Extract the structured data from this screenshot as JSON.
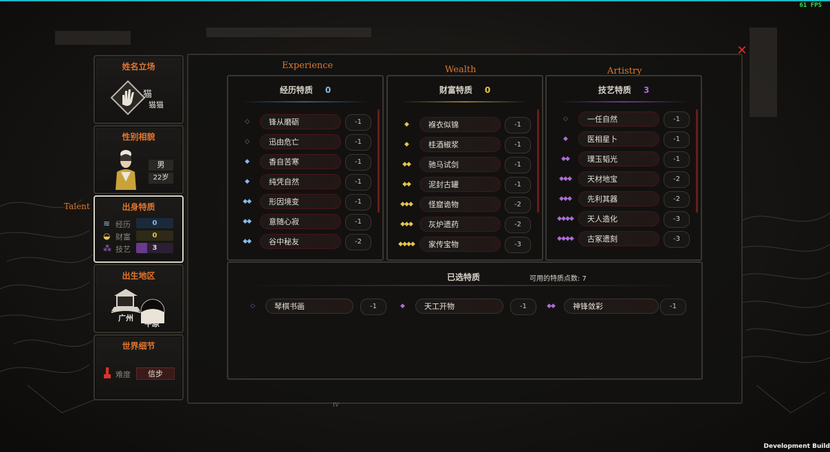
{
  "hud": {
    "fps": "61 FPS",
    "build": "Development Build"
  },
  "overlay": {
    "talent_label": "Talent"
  },
  "colors": {
    "accent_orange": "#e1752f",
    "experience_blue": "#8ab8e8",
    "wealth_gold": "#e7c44d",
    "artistry_purple": "#b06ad8",
    "close_red": "#d8332a"
  },
  "sidebar": {
    "name_section": {
      "title": "姓名立场",
      "name1": "猫",
      "name2": "猫猫",
      "icon": "palm-stance-icon"
    },
    "gender_section": {
      "title": "性别相貌",
      "gender": "男",
      "age": "22岁"
    },
    "origin_section": {
      "title": "出身特质",
      "stats": [
        {
          "label": "经历",
          "value": "0",
          "icon": "experience-icon"
        },
        {
          "label": "财富",
          "value": "0",
          "icon": "wealth-icon"
        },
        {
          "label": "技艺",
          "value": "3",
          "icon": "artistry-icon"
        }
      ]
    },
    "birthplace_section": {
      "title": "出生地区",
      "city": "广州",
      "terrain": "平原"
    },
    "world_section": {
      "title": "世界细节",
      "difficulty_label": "难度",
      "difficulty_value": "信步"
    }
  },
  "columns": [
    {
      "caption": "Experience",
      "title": "经历特质",
      "points": "0",
      "traits": [
        {
          "name": "锋从磨砺",
          "cost": "-1",
          "glyph": "◇"
        },
        {
          "name": "迅由危亡",
          "cost": "-1",
          "glyph": "◇"
        },
        {
          "name": "香自苦寒",
          "cost": "-1",
          "glyph": "◆"
        },
        {
          "name": "纯凭自然",
          "cost": "-1",
          "glyph": "◆"
        },
        {
          "name": "形因境变",
          "cost": "-1",
          "glyph": "◆◆"
        },
        {
          "name": "意随心寂",
          "cost": "-1",
          "glyph": "◆◆"
        },
        {
          "name": "谷中秘友",
          "cost": "-2",
          "glyph": "◆◆"
        }
      ]
    },
    {
      "caption": "Wealth",
      "title": "财富特质",
      "points": "0",
      "traits": [
        {
          "name": "褓衣似锦",
          "cost": "-1",
          "glyph": "◆"
        },
        {
          "name": "桂酒椒浆",
          "cost": "-1",
          "glyph": "◆"
        },
        {
          "name": "驰马试剑",
          "cost": "-1",
          "glyph": "◆◆"
        },
        {
          "name": "泥封古罐",
          "cost": "-1",
          "glyph": "◆◆"
        },
        {
          "name": "怪窟诡物",
          "cost": "-2",
          "glyph": "◆◆◆"
        },
        {
          "name": "灰炉遗药",
          "cost": "-2",
          "glyph": "◆◆◆"
        },
        {
          "name": "家传宝物",
          "cost": "-3",
          "glyph": "◆◆◆◆"
        }
      ]
    },
    {
      "caption": "Artistry",
      "title": "技艺特质",
      "points": "3",
      "traits": [
        {
          "name": "一任自然",
          "cost": "-1",
          "glyph": "◇"
        },
        {
          "name": "医相星卜",
          "cost": "-1",
          "glyph": "◆"
        },
        {
          "name": "璞玉韬光",
          "cost": "-1",
          "glyph": "◆◆"
        },
        {
          "name": "天材地宝",
          "cost": "-2",
          "glyph": "◆◆◆"
        },
        {
          "name": "先利其器",
          "cost": "-2",
          "glyph": "◆◆◆"
        },
        {
          "name": "天人造化",
          "cost": "-3",
          "glyph": "◆◆◆◆"
        },
        {
          "name": "古冢遗刻",
          "cost": "-3",
          "glyph": "◆◆◆◆"
        }
      ]
    }
  ],
  "selected": {
    "title": "已选特质",
    "available_label": "可用的特质点数: 7",
    "traits": [
      {
        "name": "琴棋书画",
        "cost": "-1",
        "glyph": "◇"
      },
      {
        "name": "天工开物",
        "cost": "-1",
        "glyph": "◆"
      },
      {
        "name": "神锋敛彩",
        "cost": "-1",
        "glyph": "◆◆"
      }
    ]
  },
  "footer_mark": "IV"
}
